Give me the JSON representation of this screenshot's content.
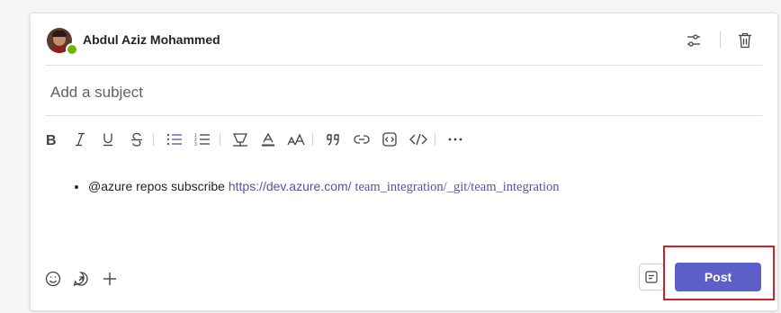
{
  "post": {
    "author": "Abdul Aziz Mohammed",
    "subject_placeholder": "Add a subject",
    "subject_value": "",
    "body": {
      "mention": "@azure repos subscribe",
      "link_part1": "https://dev.azure.com/",
      "link_part2": "team_integration/_git/team_integration"
    },
    "post_label": "Post"
  },
  "toolbar": {
    "items": [
      "bold-icon",
      "italic-icon",
      "underline-icon",
      "strikethrough-icon",
      "bullet-list-icon",
      "numbered-list-icon",
      "highlight-icon",
      "font-color-icon",
      "font-size-icon",
      "quote-icon",
      "link-icon",
      "code-snippet-icon",
      "code-icon",
      "more-options-icon"
    ]
  },
  "colors": {
    "accent": "#5b5fc7",
    "link": "#4f52b2",
    "highlight_box": "#d0202a",
    "presence": "#6bb700"
  }
}
